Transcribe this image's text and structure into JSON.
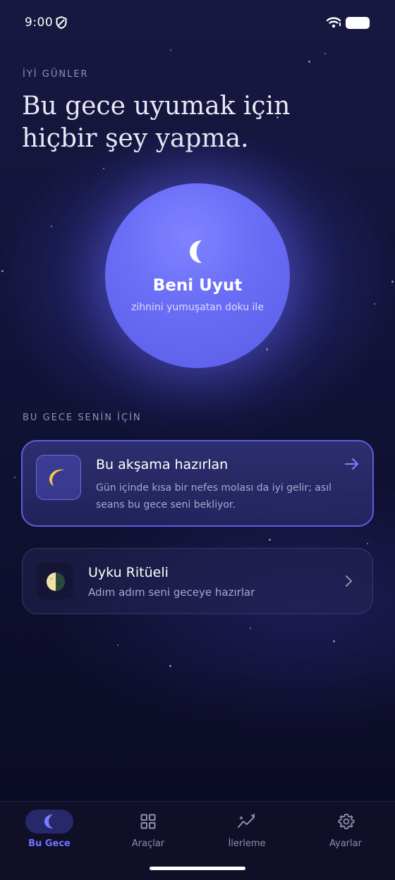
{
  "status": {
    "time": "9:00"
  },
  "greeting": "İYİ GÜNLER",
  "headline": "Bu gece uyumak için hiçbir şey yapma.",
  "orb": {
    "title": "Beni Uyut",
    "subtitle": "zihnini yumuşatan doku ile"
  },
  "section_label": "BU GECE SENİN İÇİN",
  "cards": [
    {
      "icon": "crescent-moon-emoji-icon",
      "title": "Bu akşama hazırlan",
      "body": "Gün içinde kısa bir nefes molası da iyi gelir; asıl seans bu gece seni bekliyor.",
      "action_icon": "arrow-right-icon"
    },
    {
      "icon": "half-moon-icon",
      "title": "Uyku Ritüeli",
      "body": "Adım adım seni geceye hazırlar",
      "action_icon": "chevron-right-icon"
    }
  ],
  "tabs": [
    {
      "label": "Bu Gece",
      "icon": "moon-icon",
      "active": true
    },
    {
      "label": "Araçlar",
      "icon": "grid-icon",
      "active": false
    },
    {
      "label": "İlerleme",
      "icon": "sparkle-chart-icon",
      "active": false
    },
    {
      "label": "Ayarlar",
      "icon": "gear-icon",
      "active": false
    }
  ],
  "colors": {
    "accent": "#6f72ff",
    "orb": "#6a6ef6",
    "background": "#13143a"
  }
}
